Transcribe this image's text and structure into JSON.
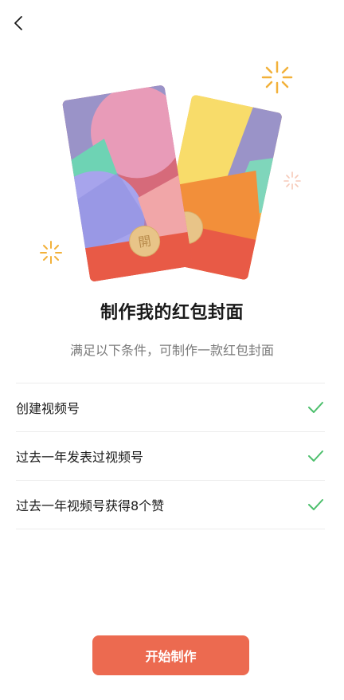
{
  "nav": {
    "back_icon": "chevron-left-icon"
  },
  "header": {
    "title": "制作我的红包封面",
    "subtitle": "满足以下条件，可制作一款红包封面"
  },
  "cover_illustration": {
    "seal_text": "開"
  },
  "conditions": [
    {
      "label": "创建视频号",
      "met": true,
      "icon": "checkmark-icon"
    },
    {
      "label": "过去一年发表过视频号",
      "met": true,
      "icon": "checkmark-icon"
    },
    {
      "label": "过去一年视频号获得8个赞",
      "met": true,
      "icon": "checkmark-icon"
    }
  ],
  "actions": {
    "start_label": "开始制作"
  },
  "colors": {
    "accent": "#ec6a50",
    "check": "#4cbf6c",
    "sparkle": "#f2b13a",
    "subtitle": "#7a7a7a"
  }
}
